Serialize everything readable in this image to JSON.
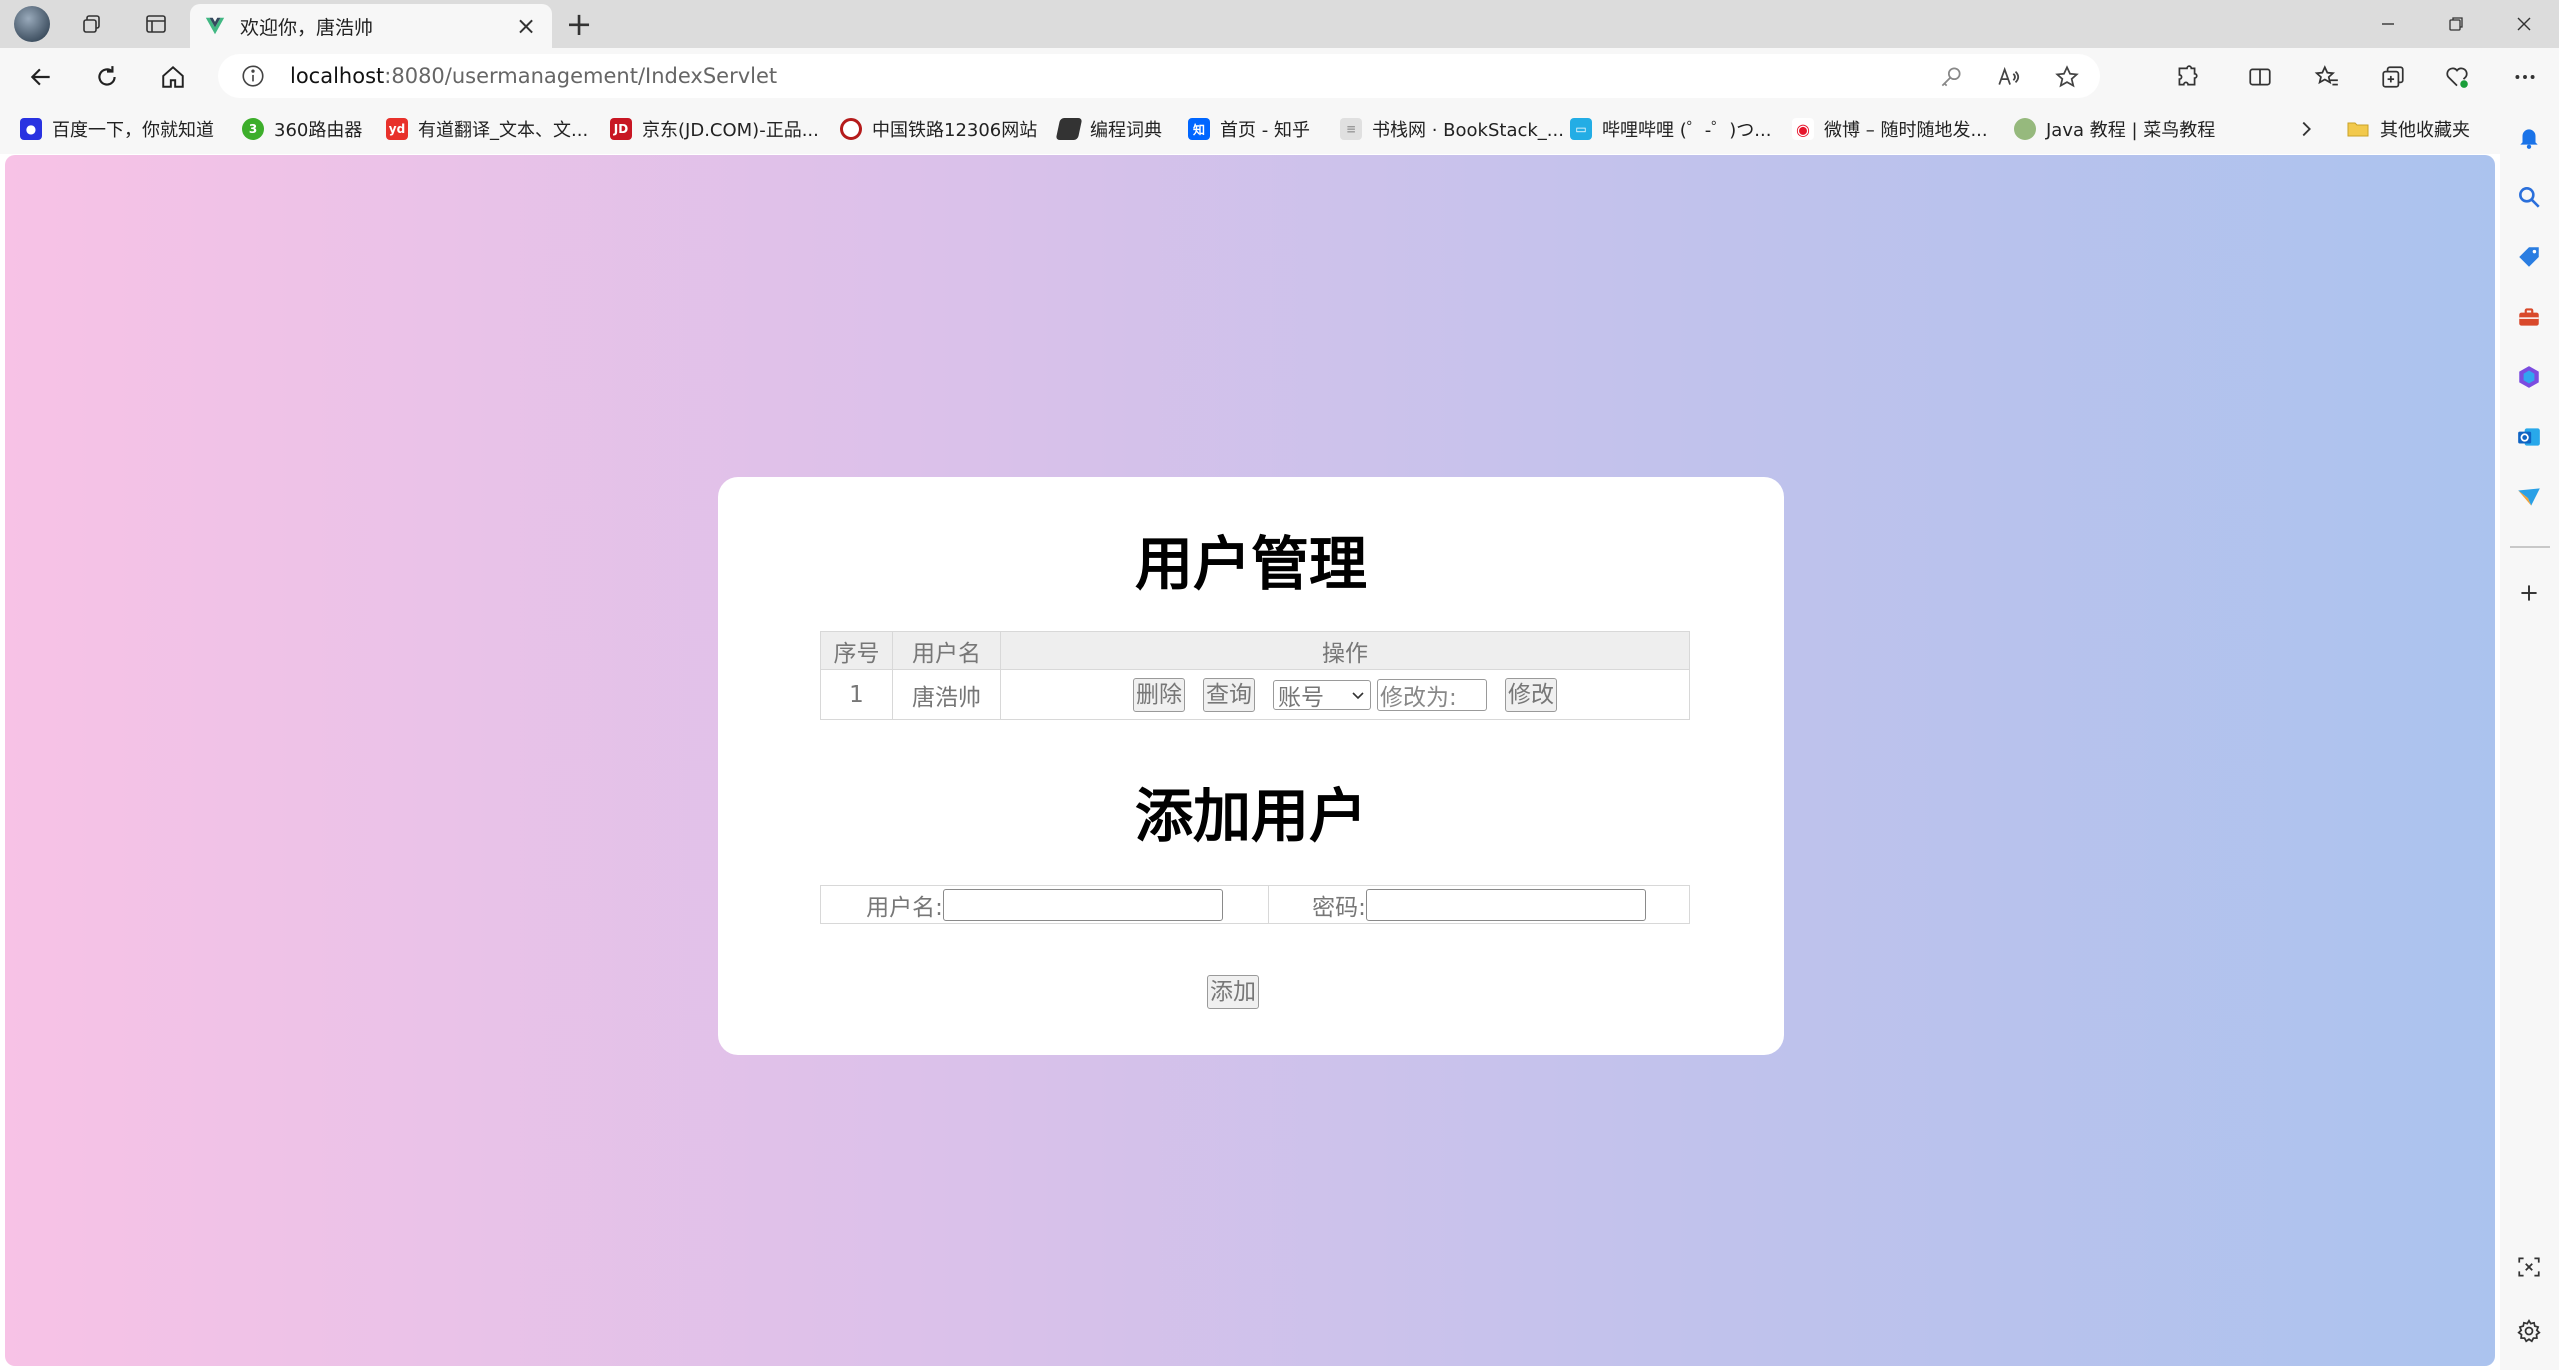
{
  "browser": {
    "tab": {
      "title": "欢迎你，唐浩帅"
    },
    "address": {
      "host": "localhost",
      "rest": ":8080/usermanagement/IndexServlet"
    },
    "bookmarks": [
      {
        "label": "百度一下，你就知道",
        "icon": "baidu-paw",
        "color": "#2932e1"
      },
      {
        "label": "360路由器",
        "icon": "360-router",
        "color": "#3dae2b"
      },
      {
        "label": "有道翻译_文本、文...",
        "icon": "youdao",
        "color": "#e8312b"
      },
      {
        "label": "京东(JD.COM)-正品...",
        "icon": "jd",
        "color": "#c81623"
      },
      {
        "label": "中国铁路12306网站",
        "icon": "12306",
        "color": "#b51b1b"
      },
      {
        "label": "编程词典",
        "icon": "dictionary",
        "color": "#333333"
      },
      {
        "label": "首页 - 知乎",
        "icon": "zhihu",
        "color": "#0066ff"
      },
      {
        "label": "书栈网 · BookStack_...",
        "icon": "bookstack",
        "color": "#cccccc"
      },
      {
        "label": "哔哩哔哩 (゜-゜)つ...",
        "icon": "bilibili",
        "color": "#23ade5"
      },
      {
        "label": "微博 – 随时随地发...",
        "icon": "weibo",
        "color": "#e6162d"
      },
      {
        "label": "Java 教程 | 菜鸟教程",
        "icon": "runoob",
        "color": "#96b97d"
      }
    ],
    "bookmarks_folder": "其他收藏夹"
  },
  "page": {
    "title": "用户管理",
    "table": {
      "headers": [
        "序号",
        "用户名",
        "操作"
      ],
      "rows": [
        {
          "index": "1",
          "username": "唐浩帅",
          "delete_label": "删除",
          "query_label": "查询",
          "field_select": "账号",
          "modify_placeholder": "修改为:",
          "modify_label": "修改"
        }
      ]
    },
    "add_section": {
      "title": "添加用户",
      "username_label": "用户名:",
      "password_label": "密码:",
      "add_label": "添加"
    }
  },
  "colors": {
    "gradient_left": "#f7c2e6",
    "gradient_right": "#abc3ee"
  }
}
